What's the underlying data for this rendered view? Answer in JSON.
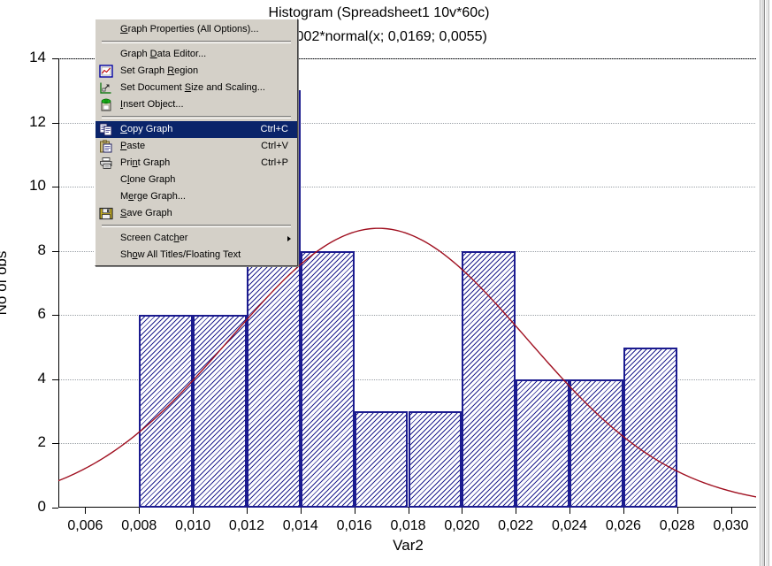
{
  "chart_data": {
    "type": "bar",
    "title": "Histogram (Spreadsheet1 10v*60c)",
    "subtitle": "0*0,002*normal(x; 0,0169; 0,0055)",
    "xlabel": "Var2",
    "ylabel": "No of obs",
    "xlim": [
      0.005,
      0.031
    ],
    "ylim": [
      0,
      14
    ],
    "grid": true,
    "legend": "none",
    "xticks": [
      "0,006",
      "0,008",
      "0,010",
      "0,012",
      "0,014",
      "0,016",
      "0,018",
      "0,020",
      "0,022",
      "0,024",
      "0,026",
      "0,028",
      "0,030"
    ],
    "xtick_values": [
      0.006,
      0.008,
      0.01,
      0.012,
      0.014,
      0.016,
      0.018,
      0.02,
      0.022,
      0.024,
      0.026,
      0.028,
      0.03
    ],
    "yticks": [
      "0",
      "2",
      "4",
      "6",
      "8",
      "10",
      "12",
      "14"
    ],
    "ytick_values": [
      0,
      2,
      4,
      6,
      8,
      10,
      12,
      14
    ],
    "bin_width": 0.002,
    "bin_starts": [
      0.008,
      0.01,
      0.012,
      0.014,
      0.016,
      0.018,
      0.02,
      0.022,
      0.024,
      0.026
    ],
    "categories": [
      "0,008-0,010",
      "0,010-0,012",
      "0,012-0,014",
      "0,014-0,016",
      "0,016-0,018",
      "0,018-0,020",
      "0,020-0,022",
      "0,022-0,024",
      "0,024-0,026",
      "0,026-0,028"
    ],
    "values": [
      6,
      6,
      13,
      8,
      3,
      3,
      8,
      4,
      4,
      5
    ],
    "bar_fill": "#ffffff",
    "bar_hatch_color": "#22228f",
    "bar_edge_color": "#1b1b8f",
    "overlay": {
      "name": "normal fit curve",
      "color": "#a01020",
      "mean": 0.0169,
      "sd": 0.0055,
      "scale": "60*0,002"
    }
  },
  "context_menu": {
    "name": "graph-context-menu",
    "selected_item": "Copy Graph",
    "items": [
      {
        "id": "graph-properties",
        "label": "Graph Properties (All Options)...",
        "accel": "",
        "icon": "none",
        "sep_after": true,
        "underline_index": 0
      },
      {
        "id": "graph-data-editor",
        "label": "Graph Data Editor...",
        "accel": "",
        "icon": "none",
        "sep_after": false,
        "underline_index": 6
      },
      {
        "id": "set-graph-region",
        "label": "Set Graph Region",
        "accel": "",
        "icon": "chart-region-icon",
        "sep_after": false,
        "underline_index": 10
      },
      {
        "id": "set-document-size",
        "label": "Set Document Size and Scaling...",
        "accel": "",
        "icon": "document-scaling-icon",
        "sep_after": false,
        "underline_index": 13
      },
      {
        "id": "insert-object",
        "label": "Insert Object...",
        "accel": "",
        "icon": "insert-object-icon",
        "sep_after": true,
        "underline_index": 0
      },
      {
        "id": "copy-graph",
        "label": "Copy Graph",
        "accel": "Ctrl+C",
        "icon": "copy-icon",
        "sep_after": false,
        "underline_index": 0
      },
      {
        "id": "paste",
        "label": "Paste",
        "accel": "Ctrl+V",
        "icon": "paste-icon",
        "sep_after": false,
        "underline_index": 0
      },
      {
        "id": "print-graph",
        "label": "Print Graph",
        "accel": "Ctrl+P",
        "icon": "printer-icon",
        "sep_after": false,
        "underline_index": 3
      },
      {
        "id": "clone-graph",
        "label": "Clone Graph",
        "accel": "",
        "icon": "none",
        "sep_after": false,
        "underline_index": 1
      },
      {
        "id": "merge-graph",
        "label": "Merge Graph...",
        "accel": "",
        "icon": "none",
        "sep_after": false,
        "underline_index": 1
      },
      {
        "id": "save-graph",
        "label": "Save Graph",
        "accel": "",
        "icon": "save-icon",
        "sep_after": true,
        "underline_index": 0
      },
      {
        "id": "screen-catcher",
        "label": "Screen Catcher",
        "accel": "",
        "icon": "none",
        "submenu": true,
        "sep_after": false,
        "underline_index": 11
      },
      {
        "id": "show-all-titles",
        "label": "Show All Titles/Floating Text",
        "accel": "",
        "icon": "none",
        "sep_after": false,
        "underline_index": 2
      }
    ]
  },
  "colors": {
    "menu_face": "#d4d0c8",
    "menu_highlight": "#0a246a",
    "bar_edge": "#1b1b8f",
    "curve": "#a01020",
    "grid": "#9aa0a6"
  }
}
